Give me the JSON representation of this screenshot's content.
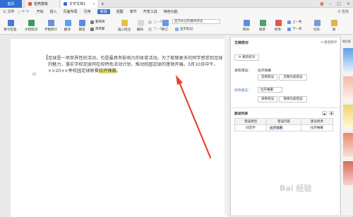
{
  "tabs": {
    "home": "首页",
    "tab1": "稻壳模板",
    "tab2": "文字文档1",
    "plus": "+"
  },
  "window": {
    "badge": "1"
  },
  "menu": {
    "file": "三 文件",
    "items": [
      "开始",
      "插入",
      "页面布局",
      "引用",
      "审阅",
      "视图",
      "章节",
      "开发工具",
      "特色功能"
    ],
    "active": "审阅",
    "search": "Q 查找"
  },
  "ribbon": {
    "spellcheck": "拼写检查·",
    "doc_proof": "文档校对",
    "word_count": "字数统计",
    "translate": "翻译·",
    "read_aloud": "朗读",
    "trad_simp": "繁转简",
    "simp_trad": "简转繁",
    "insert_comment": "插入批注",
    "delete": "删除·",
    "prev": "上一条",
    "next": "下一条",
    "track": "修订·",
    "show_markup_dropdown": "显示标记的最终状态",
    "show_markup": "显示标记·",
    "review": "审阅·",
    "accept": "接受·",
    "reject": "拒绝·",
    "prev2": "上一条",
    "next2": "下一条",
    "compare": "比较·",
    "restrict": "限"
  },
  "document": {
    "text_before": "足球是一项世界性的活动，也是最具有影响力的体育活动。为了能够更多的同学感受到足球的魅力，落实学校足球同在校特色活动计划，推动校园足球的蓬勃开展。3月10日中午，××20××季校园足球联赛",
    "highlight": "拉开锋幕",
    "text_after": "。"
  },
  "panel": {
    "title": "文档校对",
    "exit": "退出校对",
    "recheck": "重新校对",
    "found_label": "发现错误：",
    "found_value": "拉开锋幕",
    "ignore_error": "忽略错误",
    "ignore_all": "忽略同类错误",
    "suggest_label": "修改建议：",
    "suggest_value": "拉开帷幕",
    "replace_error": "替换错误",
    "replace_all": "替换同类错误",
    "list_title": "勘误列表",
    "columns": [
      "错误原因",
      "错误内容",
      "建议修改"
    ],
    "rows": [
      {
        "reason": "同音字",
        "content": "拉开锋幕",
        "fix": "拉开帷幕"
      }
    ]
  },
  "sidebar": {
    "label": "稿壳推"
  },
  "watermark": "Bai 经验",
  "colors": {
    "accent": "#3e73d6",
    "highlight": "#e9e46a",
    "arrow": "#e8433a"
  }
}
